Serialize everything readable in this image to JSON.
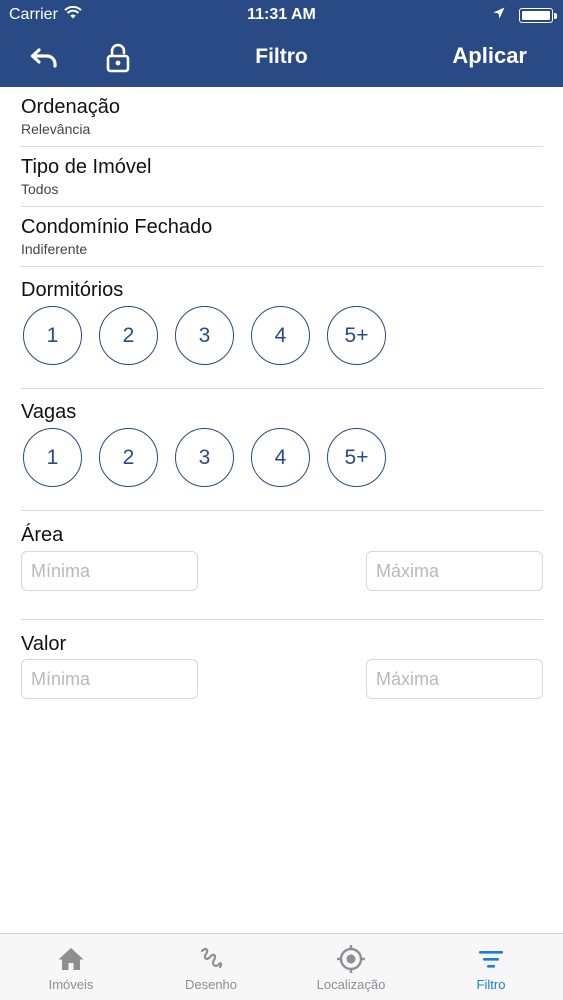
{
  "status": {
    "carrier": "Carrier",
    "time": "11:31 AM",
    "battery_level": 1.0
  },
  "header": {
    "title": "Filtro",
    "apply_label": "Aplicar",
    "color": "#2a4a85"
  },
  "sections": {
    "ordenacao": {
      "title": "Ordenação",
      "value": "Relevância"
    },
    "tipo": {
      "title": "Tipo de Imóvel",
      "value": "Todos"
    },
    "condominio": {
      "title": "Condomínio Fechado",
      "value": "Indiferente"
    },
    "dormitorios": {
      "title": "Dormitórios",
      "options": [
        "1",
        "2",
        "3",
        "4",
        "5+"
      ]
    },
    "vagas": {
      "title": "Vagas",
      "options": [
        "1",
        "2",
        "3",
        "4",
        "5+"
      ]
    },
    "area": {
      "title": "Área",
      "min_placeholder": "Mínima",
      "max_placeholder": "Máxima"
    },
    "valor": {
      "title": "Valor",
      "min_placeholder": "Mínima",
      "max_placeholder": "Máxima"
    }
  },
  "tabs": [
    {
      "label": "Imóveis",
      "icon": "home-icon"
    },
    {
      "label": "Desenho",
      "icon": "draw-icon"
    },
    {
      "label": "Localização",
      "icon": "location-target-icon"
    },
    {
      "label": "Filtro",
      "icon": "filter-icon",
      "active": true
    }
  ],
  "colors": {
    "accent": "#2a4a85",
    "tab_active": "#1a7fd8",
    "tab_inactive": "#8e8e93"
  }
}
